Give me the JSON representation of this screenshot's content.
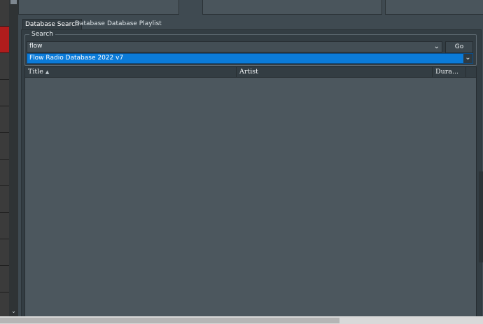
{
  "tabs": [
    {
      "label": "Database Search",
      "active": true
    },
    {
      "label": "Database",
      "active": false
    },
    {
      "label": "Database Playlist",
      "active": false
    }
  ],
  "search": {
    "group_label": "Search",
    "query": "flow",
    "go_label": "Go",
    "database_selected": "Flow Radio Database 2022 v7"
  },
  "table": {
    "columns": [
      {
        "label": "Title",
        "sort": "ascending"
      },
      {
        "label": "Artist"
      },
      {
        "label": "Dura..."
      }
    ],
    "rows": []
  },
  "icons": {
    "sort_indicator": "sort-ascending-icon",
    "dropdown": "chevron-down-icon",
    "scroll_down": "scroll-down-arrow-icon"
  },
  "colors": {
    "selection": "#0b7bd8",
    "panel": "#333d43",
    "background": "#4b565e",
    "alert": "#b01c1c"
  }
}
